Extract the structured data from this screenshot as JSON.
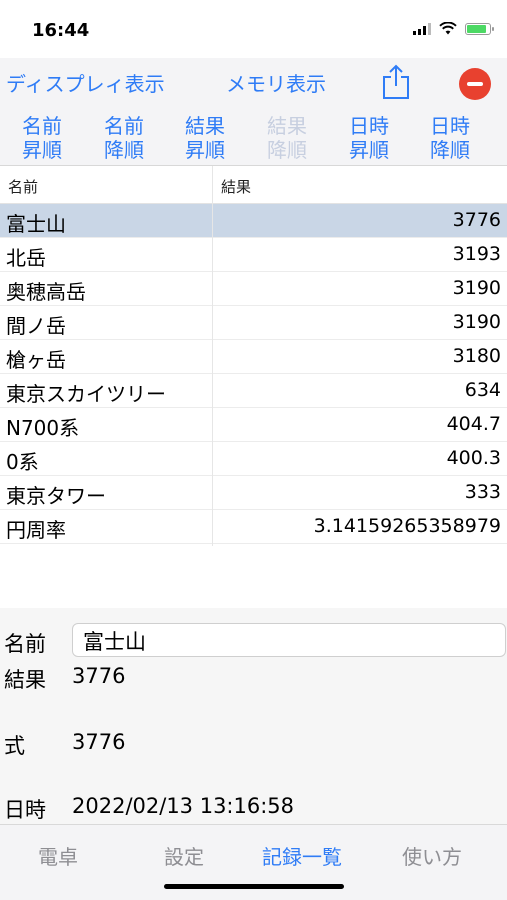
{
  "status": {
    "time": "16:44"
  },
  "toolbar": {
    "display_label": "ディスプレィ表示",
    "memory_label": "メモリ表示",
    "share_icon": "share-icon",
    "delete_icon": "minus-circle-icon",
    "accent_color": "#2f7cf6",
    "delete_color": "#e8412f"
  },
  "sort_buttons": [
    {
      "label": "名前\n昇順",
      "enabled": true
    },
    {
      "label": "名前\n降順",
      "enabled": true
    },
    {
      "label": "結果\n昇順",
      "enabled": true
    },
    {
      "label": "結果\n降順",
      "enabled": false
    },
    {
      "label": "日時\n昇順",
      "enabled": true
    },
    {
      "label": "日時\n降順",
      "enabled": true
    }
  ],
  "table": {
    "headers": {
      "name": "名前",
      "result": "結果"
    },
    "rows": [
      {
        "name": "富士山",
        "value": "3776",
        "selected": true
      },
      {
        "name": "北岳",
        "value": "3193"
      },
      {
        "name": "奥穂高岳",
        "value": "3190"
      },
      {
        "name": "間ノ岳",
        "value": "3190"
      },
      {
        "name": "槍ヶ岳",
        "value": "3180"
      },
      {
        "name": "東京スカイツリー",
        "value": "634"
      },
      {
        "name": "N700系",
        "value": "404.7"
      },
      {
        "name": "0系",
        "value": "400.3"
      },
      {
        "name": "東京タワー",
        "value": "333"
      },
      {
        "name": "円周率",
        "value": "3.14159265358979"
      }
    ]
  },
  "detail": {
    "name_label": "名前",
    "name_value": "富士山",
    "result_label": "結果",
    "result_value": "3776",
    "formula_label": "式",
    "formula_value": "3776",
    "datetime_label": "日時",
    "datetime_value": "2022/02/13 13:16:58"
  },
  "tabbar": {
    "tabs": [
      {
        "label": "電卓",
        "active": false
      },
      {
        "label": "設定",
        "active": false
      },
      {
        "label": "記録一覧",
        "active": true
      },
      {
        "label": "使い方",
        "active": false
      }
    ]
  }
}
